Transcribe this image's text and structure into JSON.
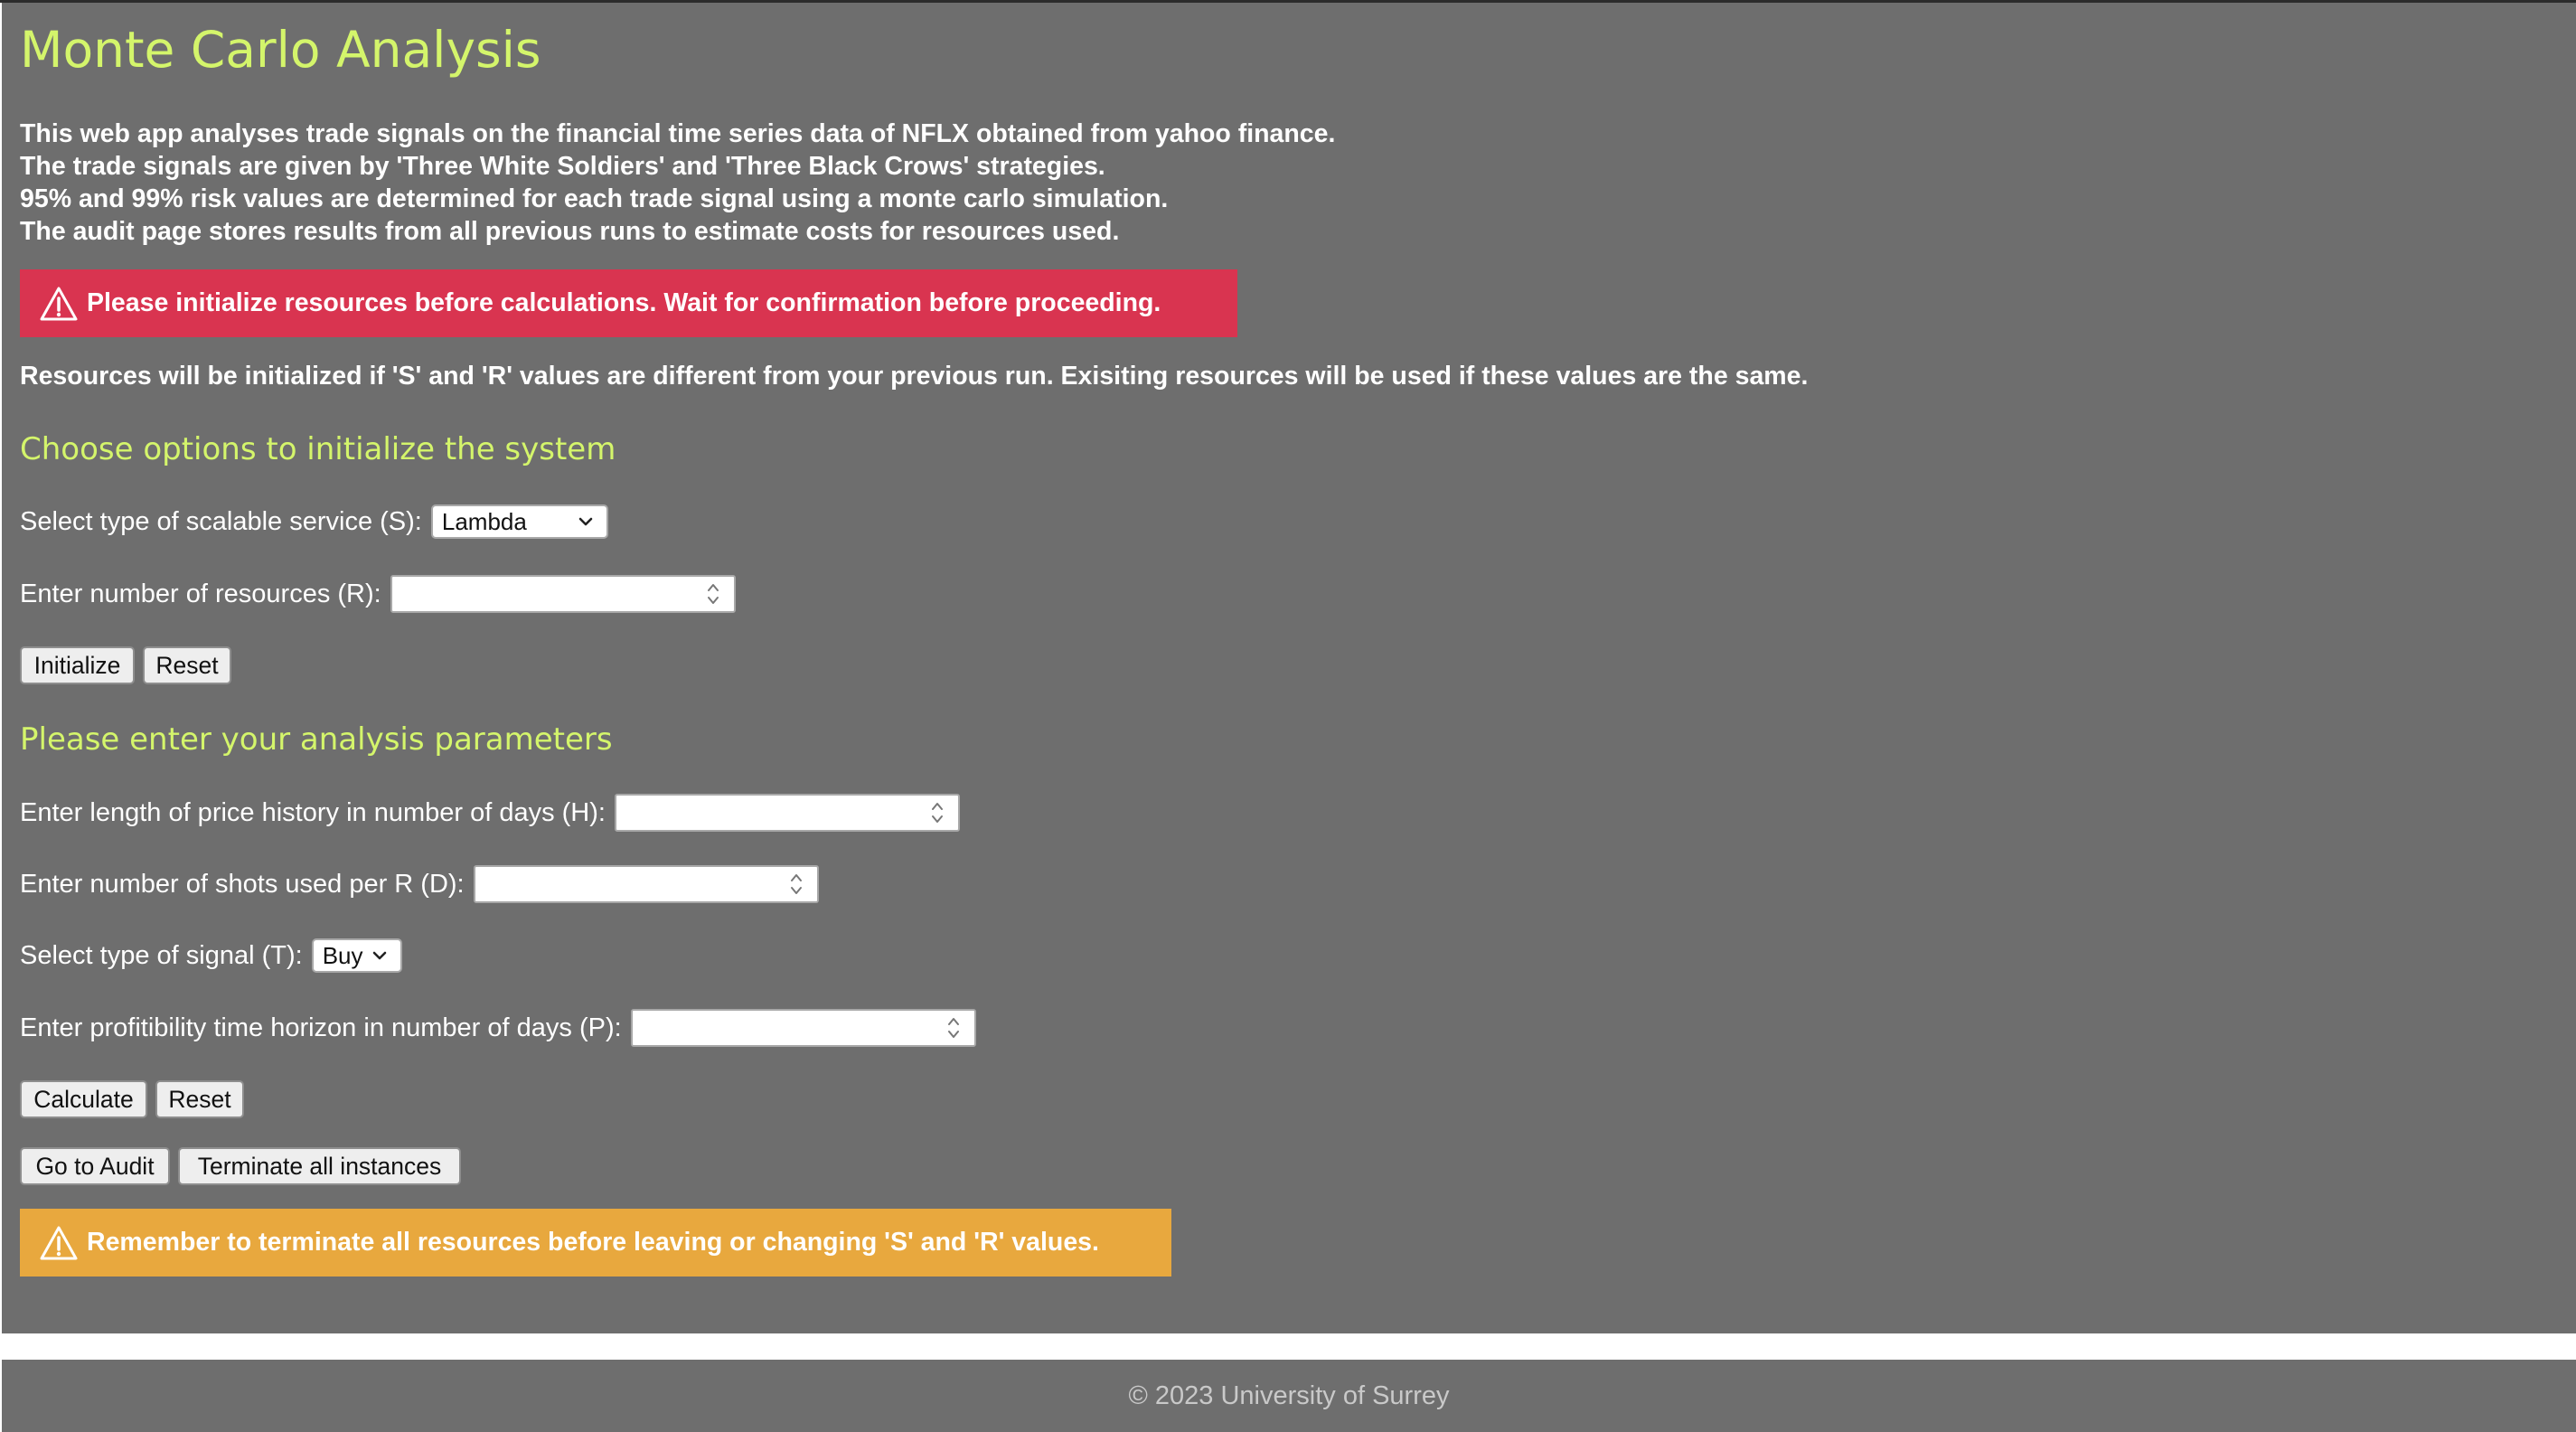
{
  "app": {
    "title": "Monte Carlo Analysis",
    "intro_lines": [
      "This web app analyses trade signals on the financial time series data of NFLX obtained from yahoo finance.",
      "The trade signals are given by 'Three White Soldiers' and 'Three Black Crows' strategies.",
      "95% and 99% risk values are determined for each trade signal using a monte carlo simulation.",
      "The audit page stores results from all previous runs to estimate costs for resources used."
    ],
    "alert_init": "Please initialize resources before calculations. Wait for confirmation before proceeding.",
    "note": "Resources will be initialized if 'S' and 'R' values are different from your previous run. Exisiting resources will be used if these values are the same.",
    "alert_terminate": "Remember to terminate all resources before leaving or changing 'S' and 'R' values.",
    "icons": {
      "alert": "warning-icon",
      "dropdown": "chevron-down-icon",
      "spinner": "spinner-arrows-icon"
    },
    "colors": {
      "background": "#6e6e6e",
      "heading": "#d4f56b",
      "danger": "#d93450",
      "warning": "#e8a83e"
    }
  },
  "init_section": {
    "heading": "Choose options to initialize the system",
    "service_label": "Select type of scalable service (S):",
    "service_value": "Lambda",
    "resources_label": "Enter number of resources (R):",
    "resources_value": "",
    "initialize_label": "Initialize",
    "reset_label": "Reset"
  },
  "analysis_section": {
    "heading": "Please enter your analysis parameters",
    "history_label": "Enter length of price history in number of days (H):",
    "history_value": "",
    "shots_label": "Enter number of shots used per R (D):",
    "shots_value": "",
    "signal_label": "Select type of signal (T):",
    "signal_value": "Buy",
    "horizon_label": "Enter profitibility time horizon in number of days (P):",
    "horizon_value": "",
    "calculate_label": "Calculate",
    "reset_label": "Reset"
  },
  "actions": {
    "audit_label": "Go to Audit",
    "terminate_label": "Terminate all instances"
  },
  "footer": {
    "text": "© 2023 University of Surrey"
  }
}
